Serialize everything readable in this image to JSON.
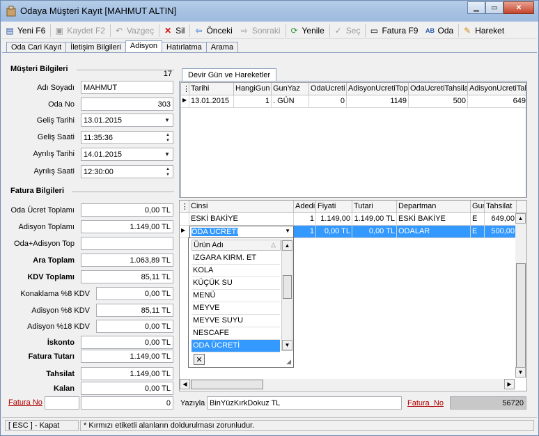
{
  "window": {
    "title": "Odaya Müşteri Kayıt [MAHMUT ALTIN]"
  },
  "toolbar": {
    "new": "Yeni F6",
    "save": "Kaydet F2",
    "cancel": "Vazgeç",
    "delete": "Sil",
    "prev": "Önceki",
    "next": "Sonraki",
    "refresh": "Yenile",
    "select": "Seç",
    "invoice": "Fatura F9",
    "room": "Oda",
    "movement": "Hareket"
  },
  "tabs": [
    "Oda Cari Kayıt",
    "İletişim Bilgileri",
    "Adisyon",
    "Hatırlatma",
    "Arama"
  ],
  "customer": {
    "section": "Müşteri Bilgileri",
    "count": "17",
    "name_label": "Adı Soyadı",
    "name": "MAHMUT",
    "room_label": "Oda No",
    "room": "303",
    "arrival_date_label": "Geliş Tarihi",
    "arrival_date": "13.01.2015",
    "arrival_time_label": "Geliş Saati",
    "arrival_time": "11:35:36",
    "departure_date_label": "Ayrılış Tarihi",
    "departure_date": "14.01.2015",
    "departure_time_label": "Ayrılış Saati",
    "departure_time": "12:30:00"
  },
  "invoice": {
    "section": "Fatura Bilgileri",
    "room_total_label": "Oda Ücret Toplamı",
    "room_total": "0,00 TL",
    "adisyon_total_label": "Adisyon Toplamı",
    "adisyon_total": "1.149,00 TL",
    "room_adisyon_label": "Oda+Adisyon Top",
    "room_adisyon": "",
    "subtotal_label": "Ara Toplam",
    "subtotal": "1.063,89 TL",
    "kdv_label": "KDV Toplamı",
    "kdv": "85,11 TL",
    "kdv_lodging_label": "Konaklama %8 KDV",
    "kdv_lodging": "0,00 TL",
    "kdv_adisyon8_label": "Adisyon %8 KDV",
    "kdv_adisyon8": "85,11 TL",
    "kdv_adisyon18_label": "Adisyon %18 KDV",
    "kdv_adisyon18": "0,00 TL",
    "discount_label": "İskonto",
    "discount": "0,00 TL",
    "invoice_total_label": "Fatura Tutarı",
    "invoice_total": "1.149,00 TL",
    "collection_label": "Tahsilat",
    "collection": "1.149,00 TL",
    "remaining_label": "Kalan",
    "remaining": "0,00 TL",
    "invoice_no_label": "Fatura No",
    "invoice_no": "",
    "invoice_no_value": "0"
  },
  "devir": {
    "tab": "Devir Gün ve Hareketler",
    "columns": [
      "Tarihi",
      "HangiGun",
      "GunYaz",
      "OdaUcreti",
      "AdisyonUcretiTop",
      "OdaUcretiTahsilat",
      "AdisyonUcretiTahsilat"
    ],
    "rows": [
      [
        "13.01.2015",
        "1",
        ". GÜN",
        "0",
        "1149",
        "500",
        "649"
      ]
    ]
  },
  "items": {
    "columns": [
      "Cinsi",
      "Adedi",
      "Fiyati",
      "Tutari",
      "Departman",
      "Gun",
      "Tahsilat"
    ],
    "rows": [
      [
        "ESKİ BAKİYE",
        "1",
        "1.149,00",
        "1.149,00 TL",
        "ESKİ BAKİYE",
        "E",
        "649,00"
      ],
      [
        "ODA ÜCRETİ",
        "1",
        "0,00 TL",
        "0,00 TL",
        "ODALAR",
        "E",
        "500,00"
      ]
    ]
  },
  "product_dropdown": {
    "header": "Ürün Adı",
    "items": [
      "IZGARA KIRM. ET",
      "KOLA",
      "KÜÇÜK SU",
      "MENÜ",
      "MEYVE",
      "MEYVE SUYU",
      "NESCAFE",
      "ODA ÜCRETİ"
    ],
    "selected": "ODA ÜCRETİ"
  },
  "bottom": {
    "written_label": "Yazıyla",
    "written": "BinYüzKırkDokuz TL",
    "invoice_no_label": "Fatura_No",
    "invoice_no": "56720"
  },
  "statusbar": {
    "esc": "[ ESC ] - Kapat",
    "note": "* Kırmızı etiketli alanların doldurulması zorunludur."
  },
  "colors": {
    "selection": "#3399ff",
    "title_bar": "#a4c0e2",
    "required_label": "#b00000"
  }
}
